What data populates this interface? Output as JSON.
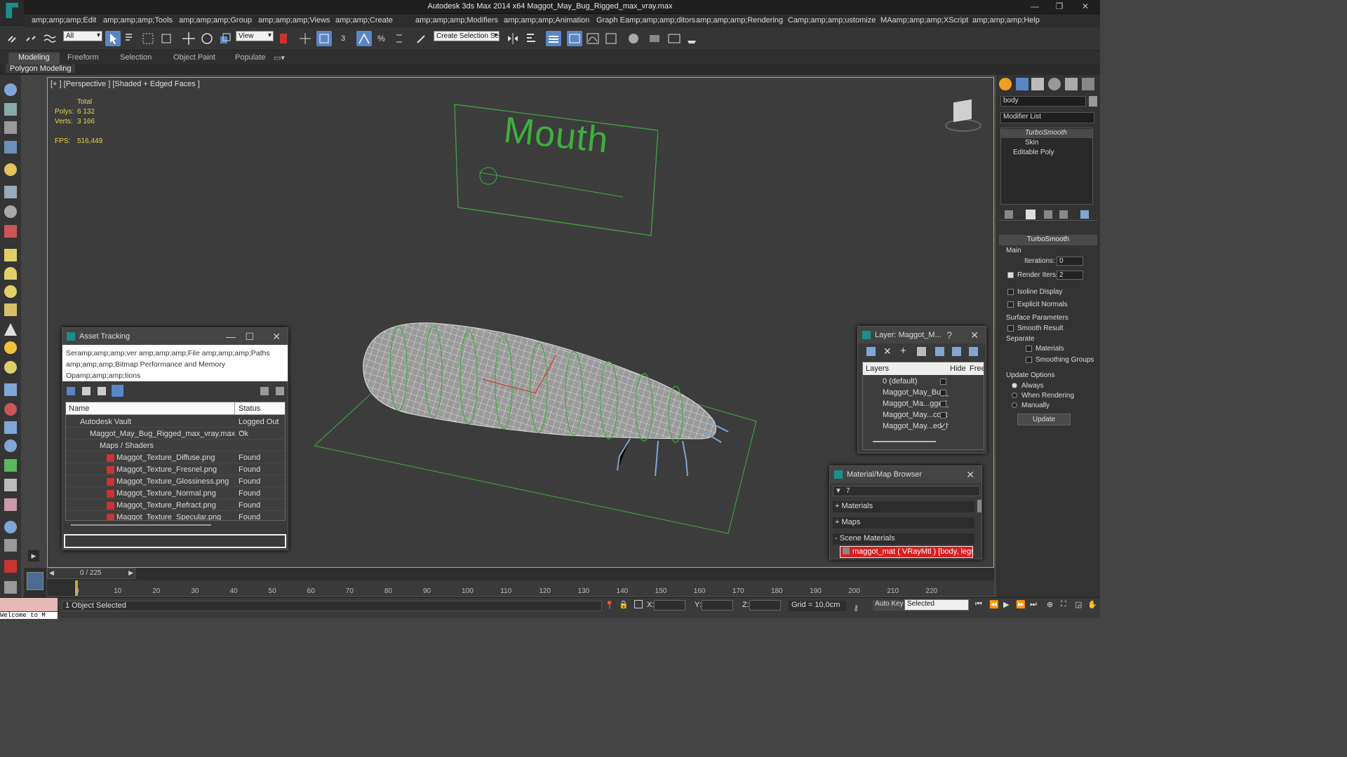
{
  "window": {
    "title": "Autodesk 3ds Max  2014 x64     Maggot_May_Bug_Rigged_max_vray.max"
  },
  "menu": [
    "amp;amp;amp;Edit",
    "amp;amp;amp;Tools",
    "amp;amp;amp;Group",
    "amp;amp;amp;Views",
    "amp;amp;Create",
    "amp;amp;amp;Modifiers",
    "amp;amp;amp;Animation",
    "Graph Eamp;amp;amp;ditors",
    "amp;amp;amp;Rendering",
    "Camp;amp;amp;ustomize",
    "MAamp;amp;amp;XScript",
    "amp;amp;amp;Help"
  ],
  "toolbar": {
    "selection_filter": "All",
    "ref_coord": "View",
    "named_selection": "Create Selection Se"
  },
  "ribbon": {
    "tabs": [
      "Modeling",
      "Freeform",
      "Selection",
      "Object Paint",
      "Populate"
    ],
    "active_tab": "Modeling",
    "subpanel": "Polygon Modeling"
  },
  "viewport": {
    "label": "[+ ] [Perspective ] [Shaded + Edged Faces ]",
    "stats": {
      "total": "Total",
      "polys_label": "Polys:",
      "polys": "6 132",
      "verts_label": "Verts:",
      "verts": "3 166",
      "fps_label": "FPS:",
      "fps": "516,449"
    },
    "mouth_text": "Mouth"
  },
  "command_panel": {
    "object_name": "body",
    "modifier_list": "Modifier List",
    "stack": [
      "TurboSmooth",
      "Skin",
      "Editable Poly"
    ],
    "rollout_title": "TurboSmooth",
    "main_label": "Main",
    "iterations_label": "Iterations:",
    "iterations": "0",
    "render_iters_label": "Render Iters:",
    "render_iters": "2",
    "isoline": "Isoline Display",
    "explicit_normals": "Explicit Normals",
    "surface_params": "Surface Parameters",
    "smooth_result": "Smooth Result",
    "separate": "Separate",
    "materials": "Materials",
    "smoothing_groups": "Smoothing Groups",
    "update_options": "Update Options",
    "always": "Always",
    "when_rendering": "When Rendering",
    "manually": "Manually",
    "update_btn": "Update"
  },
  "asset_tracking": {
    "title": "Asset Tracking",
    "menu_line1": "Seramp;amp;amp;ver    amp;amp;amp;File    amp;amp;amp;Paths",
    "menu_line2": "amp;amp;amp;Bitmap Performance and Memory",
    "menu_line3": "Opamp;amp;amp;tions",
    "col_name": "Name",
    "col_status": "Status",
    "rows": [
      {
        "name": "Autodesk Vault",
        "status": "Logged Out ..."
      },
      {
        "name": "Maggot_May_Bug_Rigged_max_vray.max",
        "status": "Ok"
      },
      {
        "name": "Maps / Shaders",
        "status": ""
      },
      {
        "name": "Maggot_Texture_Diffuse.png",
        "status": "Found"
      },
      {
        "name": "Maggot_Texture_Fresnel.png",
        "status": "Found"
      },
      {
        "name": "Maggot_Texture_Glossiness.png",
        "status": "Found"
      },
      {
        "name": "Maggot_Texture_Normal.png",
        "status": "Found"
      },
      {
        "name": "Maggot_Texture_Refract.png",
        "status": "Found"
      },
      {
        "name": "Maggot_Texture_Specular.png",
        "status": "Found"
      }
    ]
  },
  "layers": {
    "title": "Layer: Maggot_M...",
    "help": "?",
    "col_layers": "Layers",
    "col_hide": "Hide",
    "col_freeze": "Free",
    "rows": [
      "0 (default)",
      "Maggot_May_Bug_F",
      "Maggot_Ma...gged_",
      "Maggot_May...cont",
      "Maggot_May...ed_h"
    ]
  },
  "material_browser": {
    "title": "Material/Map Browser",
    "search": "7",
    "sections": [
      "+ Materials",
      "+ Maps",
      "- Scene Materials"
    ],
    "scene_material": "maggot_mat  ( VRayMtl )  [body, legs]"
  },
  "timeline": {
    "frame": "0 / 225",
    "ticks": [
      "0",
      "10",
      "20",
      "30",
      "40",
      "50",
      "60",
      "70",
      "80",
      "90",
      "100",
      "110",
      "120",
      "130",
      "140",
      "150",
      "160",
      "170",
      "180",
      "190",
      "200",
      "210",
      "220"
    ]
  },
  "status": {
    "objects_selected": "1 Object Selected",
    "welcome": "Welcome to M",
    "x_label": "X:",
    "y_label": "Y:",
    "z_label": "Z:",
    "grid": "Grid = 10,0cm",
    "auto_key": "Auto Key",
    "key_mode": "Selected"
  },
  "colors": {
    "accent": "#5a86c6",
    "viewport_border": "#cfa33a",
    "wire_green": "#3fae3f",
    "stats_yellow": "#e9d44a"
  }
}
